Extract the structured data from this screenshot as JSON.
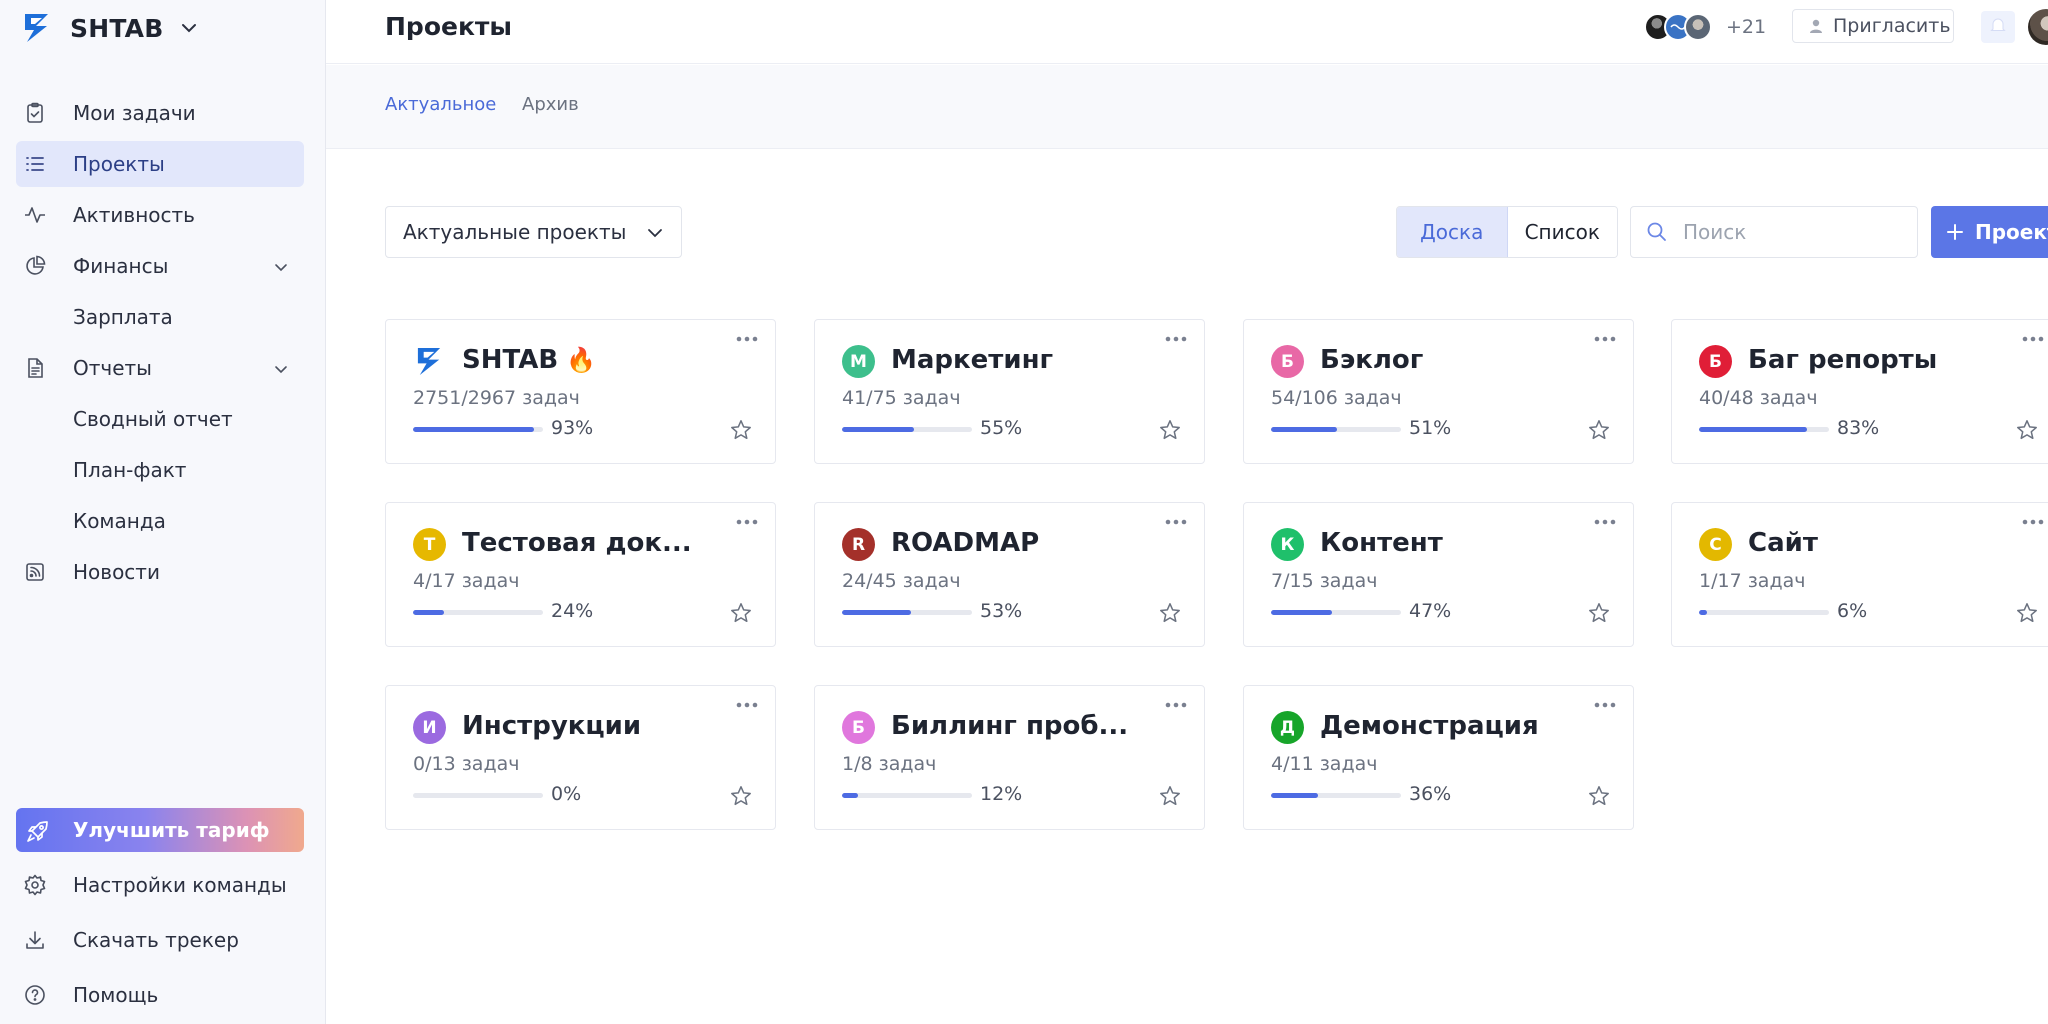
{
  "sidebar": {
    "brand": "SHTAB",
    "items": [
      {
        "label": "Мои задачи",
        "icon": "clipboard-check-icon",
        "active": false
      },
      {
        "label": "Проекты",
        "icon": "list-icon",
        "active": true
      },
      {
        "label": "Активность",
        "icon": "activity-pulse-icon",
        "active": false
      },
      {
        "label": "Финансы",
        "icon": "pie-chart-icon",
        "active": false,
        "expandable": true
      },
      {
        "label": "Зарплата",
        "sub": true
      },
      {
        "label": "Отчеты",
        "icon": "document-icon",
        "active": false,
        "expandable": true
      },
      {
        "label": "Сводный отчет",
        "sub": true
      },
      {
        "label": "План-факт",
        "sub": true
      },
      {
        "label": "Команда",
        "sub": true
      },
      {
        "label": "Новости",
        "icon": "rss-icon",
        "active": false
      }
    ],
    "upgrade": "Улучшить тариф",
    "bottom": [
      {
        "label": "Настройки команды",
        "icon": "gear-icon"
      },
      {
        "label": "Скачать трекер",
        "icon": "download-icon"
      },
      {
        "label": "Помощь",
        "icon": "help-circle-icon"
      }
    ]
  },
  "header": {
    "title": "Проекты",
    "avatars_more": "+21",
    "invite_label": "Пригласить"
  },
  "tabs": [
    {
      "label": "Актуальное",
      "active": true
    },
    {
      "label": "Архив",
      "active": false
    }
  ],
  "toolbar": {
    "filter_label": "Актуальные проекты",
    "view_board": "Доска",
    "view_list": "Список",
    "search_placeholder": "Поиск",
    "add_label": "Проект"
  },
  "colors": {
    "accent": "#5b76e6",
    "progress": "#4d6be3"
  },
  "projects": [
    {
      "name": "SHTAB",
      "logo": true,
      "emoji": "🔥",
      "tasks": "2751/2967 задач",
      "progress": 93,
      "pct": "93%"
    },
    {
      "name": "Маркетинг",
      "initial": "М",
      "color": "#3dbf8c",
      "tasks": "41/75 задач",
      "progress": 55,
      "pct": "55%"
    },
    {
      "name": "Бэклог",
      "initial": "Б",
      "color": "#e868a6",
      "tasks": "54/106 задач",
      "progress": 51,
      "pct": "51%"
    },
    {
      "name": "Баг репорты",
      "initial": "Б",
      "color": "#e01e37",
      "tasks": "40/48 задач",
      "progress": 83,
      "pct": "83%"
    },
    {
      "name": "Тестовая док...",
      "initial": "Т",
      "color": "#e6b800",
      "tasks": "4/17 задач",
      "progress": 24,
      "pct": "24%"
    },
    {
      "name": "ROADMAP",
      "initial": "R",
      "color": "#a4302a",
      "tasks": "24/45 задач",
      "progress": 53,
      "pct": "53%"
    },
    {
      "name": "Контент",
      "initial": "К",
      "color": "#1fc06b",
      "tasks": "7/15 задач",
      "progress": 47,
      "pct": "47%"
    },
    {
      "name": "Сайт",
      "initial": "С",
      "color": "#e3b800",
      "tasks": "1/17 задач",
      "progress": 6,
      "pct": "6%"
    },
    {
      "name": "Инструкции",
      "initial": "И",
      "color": "#9b6ae0",
      "tasks": "0/13 задач",
      "progress": 0,
      "pct": "0%"
    },
    {
      "name": "Биллинг проб...",
      "initial": "Б",
      "color": "#e077dd",
      "tasks": "1/8 задач",
      "progress": 12,
      "pct": "12%"
    },
    {
      "name": "Демонстрация",
      "initial": "Д",
      "color": "#17a52a",
      "tasks": "4/11 задач",
      "progress": 36,
      "pct": "36%"
    }
  ]
}
